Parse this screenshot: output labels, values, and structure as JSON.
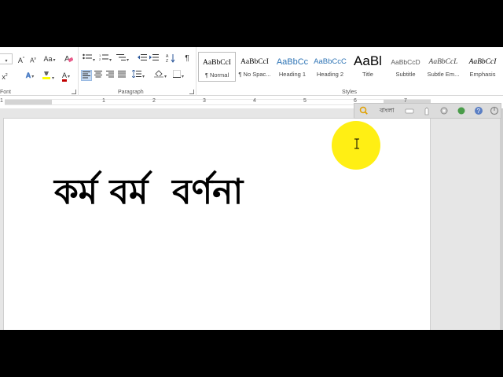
{
  "ribbon": {
    "font": {
      "label": "Font",
      "grow_label": "A",
      "shrink_label": "A",
      "case_label": "Aa",
      "subscript_label": "x",
      "effects_label": "A",
      "color_label": "A"
    },
    "paragraph": {
      "label": "Paragraph",
      "pilcrow": "¶"
    },
    "styles": {
      "label": "Styles",
      "items": [
        {
          "preview": "AaBbCcI",
          "name": "¶ Normal"
        },
        {
          "preview": "AaBbCcI",
          "name": "¶ No Spac..."
        },
        {
          "preview": "AaBbCc",
          "name": "Heading 1"
        },
        {
          "preview": "AaBbCcC",
          "name": "Heading 2"
        },
        {
          "preview": "AaBl",
          "name": "Title"
        },
        {
          "preview": "AaBbCcD",
          "name": "Subtitle"
        },
        {
          "preview": "AaBbCcL",
          "name": "Subtle Em..."
        },
        {
          "preview": "AaBbCcI",
          "name": "Emphasis"
        }
      ]
    }
  },
  "ruler": {
    "numbers": [
      "1",
      "1",
      "2",
      "3",
      "4",
      "5",
      "6",
      "7"
    ]
  },
  "document": {
    "text": "কর্ম বর্ম  বর্ণনা"
  },
  "avro_toolbar": {
    "language": "বাংলা"
  },
  "colors": {
    "highlight": "#ffee00",
    "accent_blue": "#2b579a",
    "font_color_red": "#c00000",
    "text_highlight_yellow": "#ffff00"
  },
  "icons": [
    "grow-font-icon",
    "shrink-font-icon",
    "change-case-icon",
    "clear-format-icon",
    "bullets-icon",
    "numbering-icon",
    "multilevel-list-icon",
    "decrease-indent-icon",
    "increase-indent-icon",
    "sort-icon",
    "show-marks-icon",
    "align-left-icon",
    "align-center-icon",
    "align-right-icon",
    "justify-icon",
    "line-spacing-icon",
    "shading-icon",
    "borders-icon",
    "avro-search-icon",
    "avro-keyboard-icon",
    "avro-settings-icon",
    "avro-help-icon"
  ]
}
